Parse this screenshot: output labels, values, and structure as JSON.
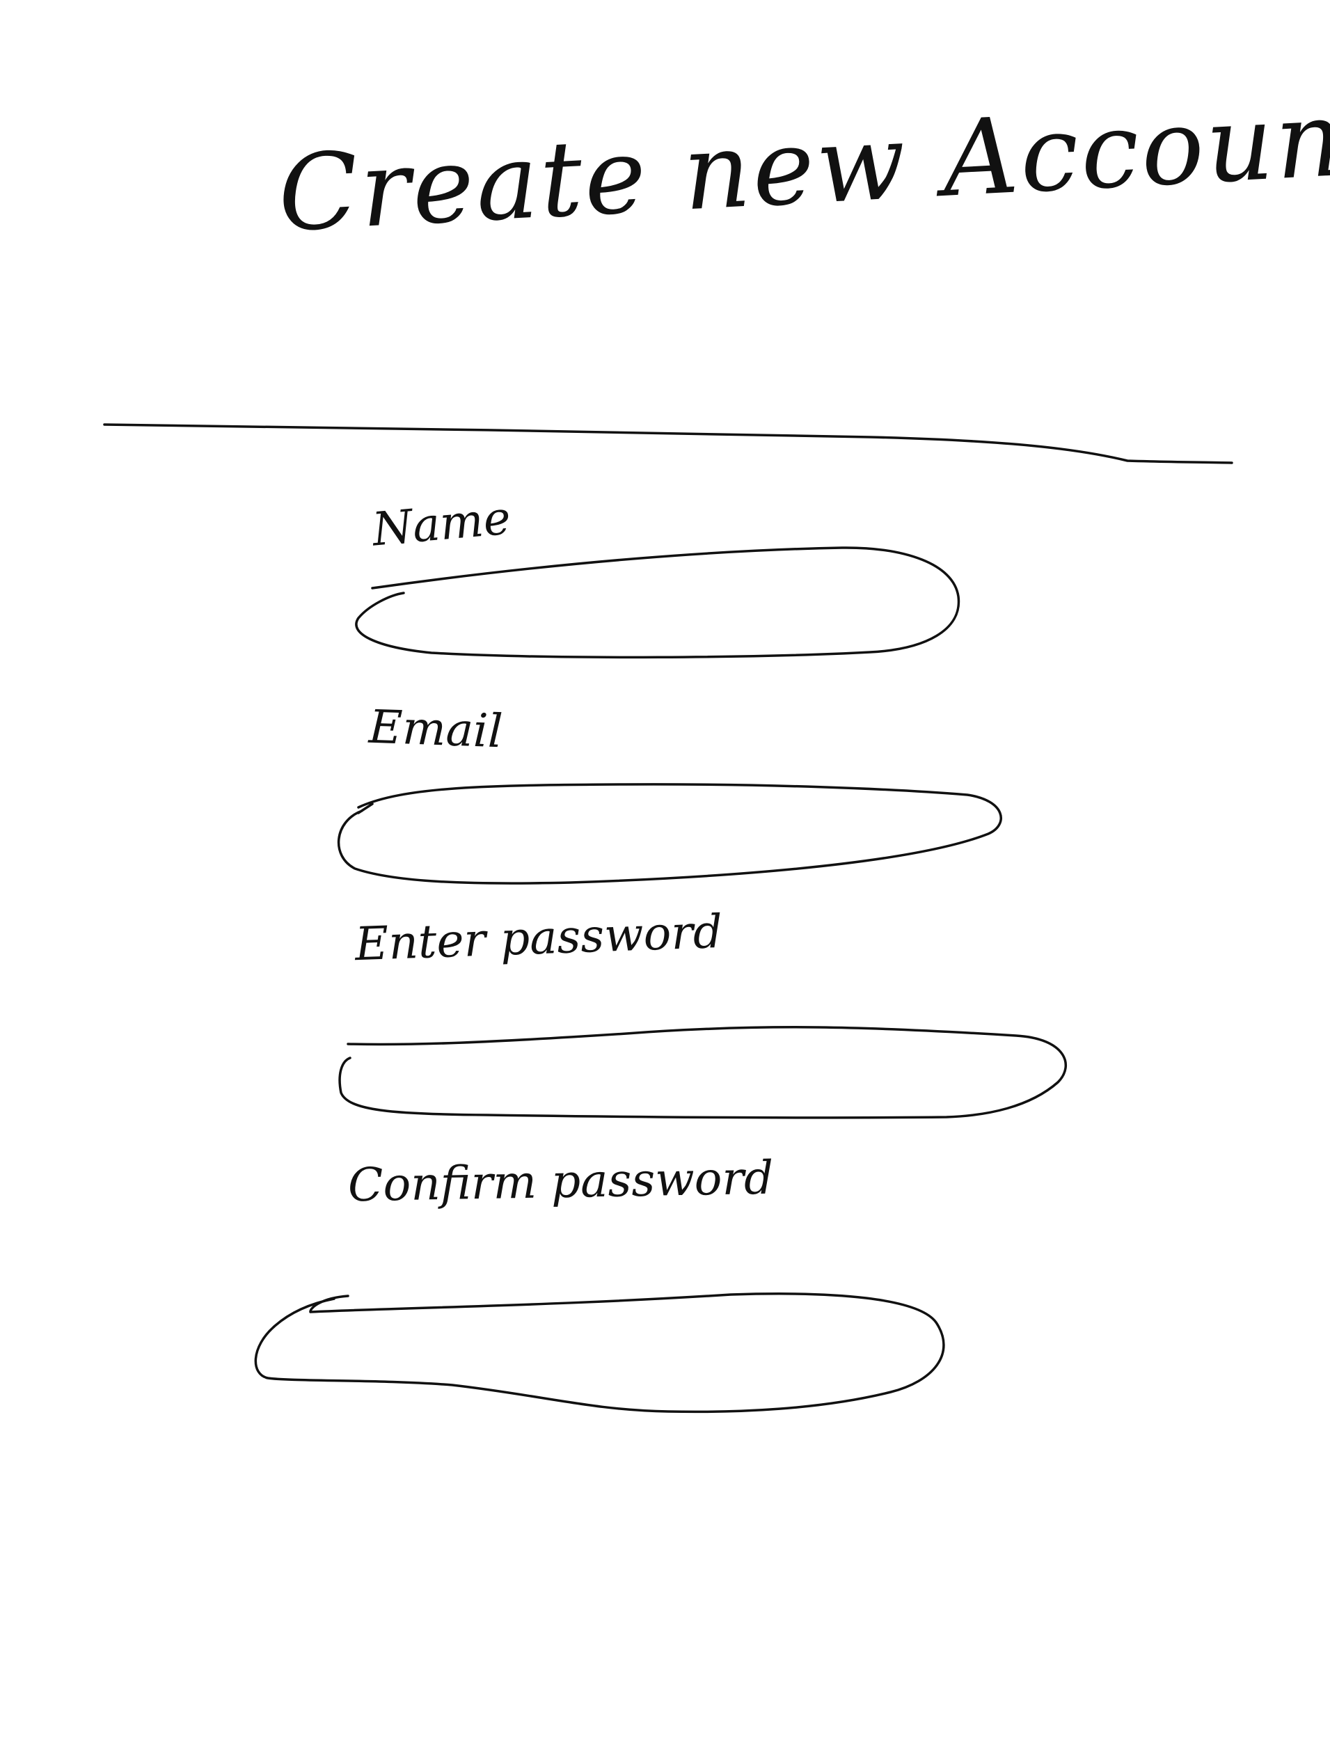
{
  "page": {
    "title": "Create new Account"
  },
  "form": {
    "fields": [
      {
        "label": "Name",
        "value": ""
      },
      {
        "label": "Email",
        "value": ""
      },
      {
        "label": "Enter password",
        "value": ""
      },
      {
        "label": "Confirm password",
        "value": ""
      }
    ]
  },
  "colors": {
    "ink": "#111111",
    "paper": "#ffffff"
  }
}
